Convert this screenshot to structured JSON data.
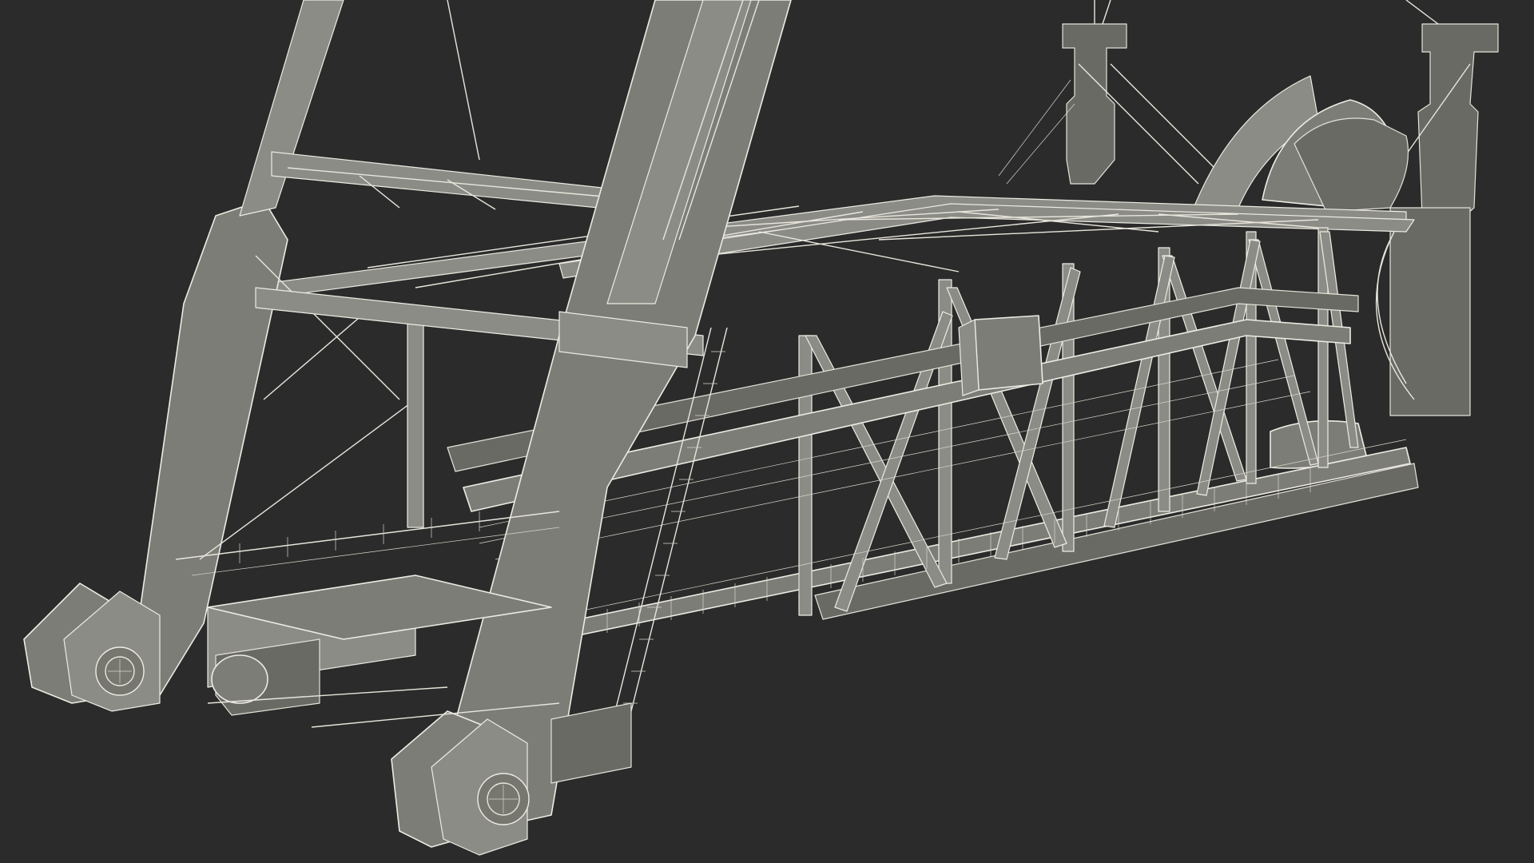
{
  "scene": {
    "background": "#2b2b2b",
    "wire_color": "#e8e6dc",
    "surface_color": "#7d7d77",
    "render_style": "wireframe-over-shaded",
    "subject": []
  }
}
